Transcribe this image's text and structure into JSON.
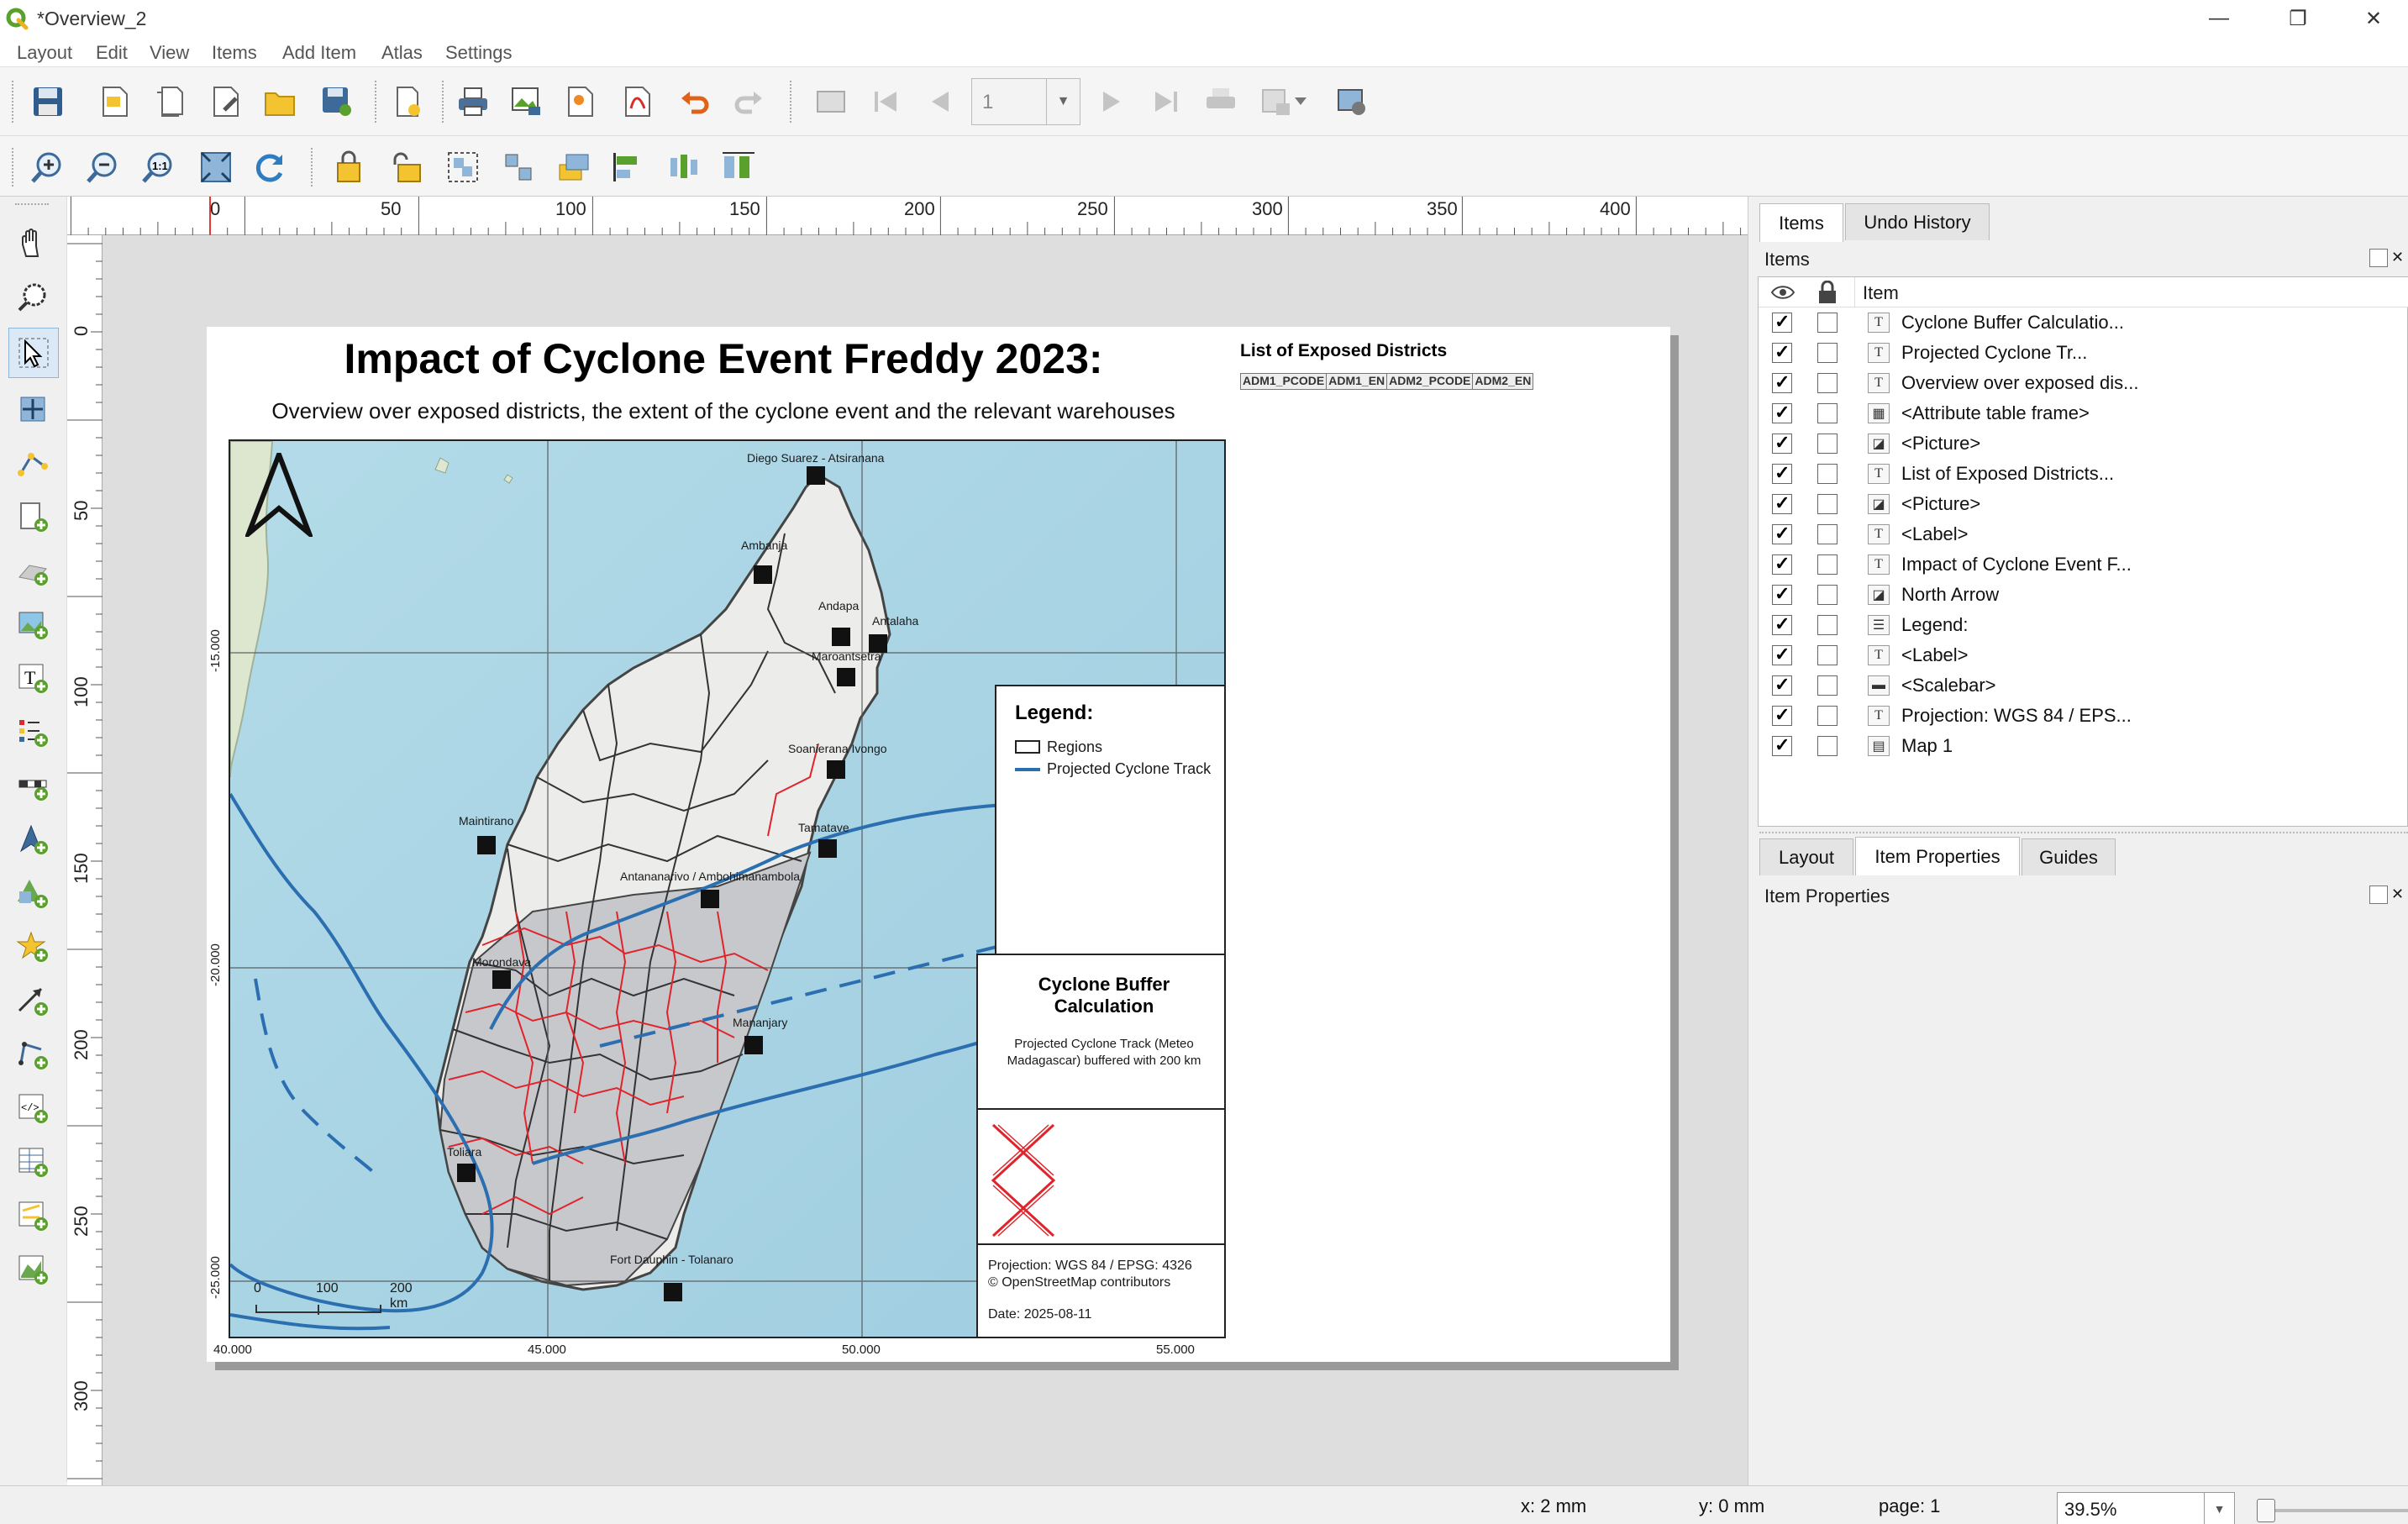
{
  "window": {
    "title": "*Overview_2",
    "minimize": "—",
    "maximize": "❐",
    "close": "✕"
  },
  "menu": [
    "Layout",
    "Edit",
    "View",
    "Items",
    "Add Item",
    "Atlas",
    "Settings"
  ],
  "toolbar": {
    "page_number": "1"
  },
  "ruler": {
    "h_labels": [
      "0",
      "50",
      "100",
      "150",
      "200",
      "250",
      "300",
      "350",
      "400"
    ],
    "v_labels": [
      "0",
      "50",
      "100",
      "150",
      "200",
      "250",
      "300"
    ]
  },
  "layout": {
    "title": "Impact of Cyclone Event Freddy 2023:",
    "subtitle": "Overview over exposed districts, the extent of the cyclone event and the relevant warehouses",
    "exposed_title": "List of Exposed Districts",
    "table_headers": [
      "ADM1_PCODE",
      "ADM1_EN",
      "ADM2_PCODE",
      "ADM2_EN"
    ],
    "legend": {
      "title": "Legend:",
      "items": [
        {
          "label": "Regions",
          "symbol": "polygon"
        },
        {
          "label": "Projected Cyclone Track",
          "symbol": "line",
          "color": "#2b6fb0"
        }
      ]
    },
    "buffer": {
      "title": "Cyclone Buffer Calculation",
      "text": "Projected Cyclone Track (Meteo Madagascar) buffered with 200 km"
    },
    "info": {
      "projection": "Projection: WGS 84 / EPSG: 4326",
      "credits": "© OpenStreetMap contributors",
      "date": "Date: 2025-08-11"
    },
    "scalebar": {
      "labels": [
        "0",
        "100",
        "200 km"
      ]
    },
    "grid": {
      "x_labels": [
        "40.000",
        "45.000",
        "50.000",
        "55.000"
      ],
      "y_labels": [
        "-15.000",
        "-20.000",
        "-25.000"
      ]
    },
    "warehouses": [
      "Diego Suarez - Atsiranana",
      "Ambanja",
      "Andapa",
      "Antalaha",
      "Maroantsetra",
      "Soanierana Ivongo",
      "Maintirano",
      "Tamatave",
      "Antananarivo / Ambohimanambola",
      "Morondava",
      "Mananjary",
      "Toliara",
      "Fort Dauphin - Tolanaro"
    ]
  },
  "dock": {
    "tabs_top": [
      "Items",
      "Undo History"
    ],
    "items_header": "Items",
    "columns": {
      "item": "Item"
    },
    "items": [
      {
        "name": "Cyclone Buffer Calculatio...",
        "type": "T",
        "visible": true
      },
      {
        "name": "Projected Cyclone Tr...",
        "type": "T",
        "visible": true
      },
      {
        "name": "Overview over exposed dis...",
        "type": "T",
        "visible": true
      },
      {
        "name": "<Attribute table frame>",
        "type": "▦",
        "visible": true
      },
      {
        "name": "<Picture>",
        "type": "◪",
        "visible": true
      },
      {
        "name": "List of Exposed Districts...",
        "type": "T",
        "visible": true
      },
      {
        "name": "<Picture>",
        "type": "◪",
        "visible": true
      },
      {
        "name": "<Label>",
        "type": "T",
        "visible": true
      },
      {
        "name": "Impact of Cyclone Event F...",
        "type": "T",
        "visible": true
      },
      {
        "name": "North Arrow",
        "type": "◪",
        "visible": true
      },
      {
        "name": "Legend:",
        "type": "☰",
        "visible": true
      },
      {
        "name": "<Label>",
        "type": "T",
        "visible": true
      },
      {
        "name": "<Scalebar>",
        "type": "▬",
        "visible": true
      },
      {
        "name": "Projection: WGS 84 / EPS...",
        "type": "T",
        "visible": true
      },
      {
        "name": "Map 1",
        "type": "▤",
        "visible": true
      }
    ],
    "tabs_bottom": [
      "Layout",
      "Item Properties",
      "Guides"
    ],
    "properties_header": "Item Properties"
  },
  "status": {
    "x": "x: 2 mm",
    "y": "y: 0 mm",
    "page": "page: 1",
    "zoom": "39.5%",
    "zoom_percent": 39.5
  }
}
